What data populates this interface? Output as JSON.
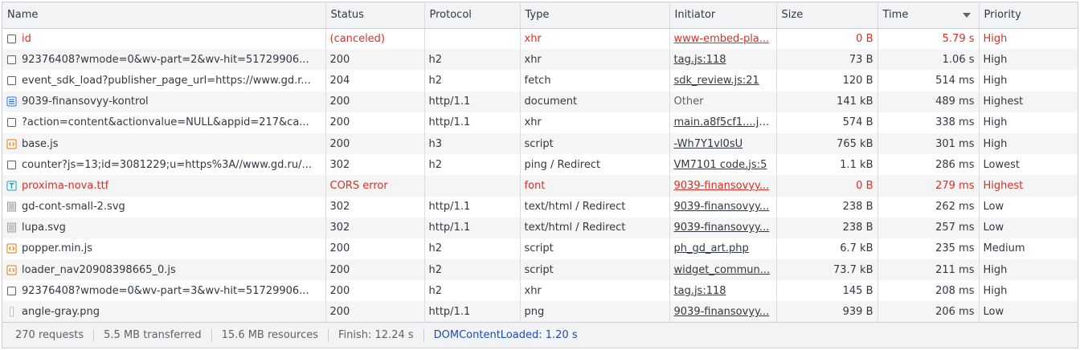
{
  "columns": {
    "name": "Name",
    "status": "Status",
    "protocol": "Protocol",
    "type": "Type",
    "initiator": "Initiator",
    "size": "Size",
    "time": "Time",
    "priority": "Priority"
  },
  "sort": {
    "column": "time",
    "direction": "descending"
  },
  "colors": {
    "error": "#d93025",
    "doc_icon": "#1a73e8",
    "script_icon": "#e37400",
    "font_icon": "#129eaf",
    "dcl": "#1a4cc7"
  },
  "rows": [
    {
      "icon": "generic-file-icon",
      "name": "id",
      "status": "(canceled)",
      "protocol": "",
      "type": "xhr",
      "initiator": "www-embed-pla...",
      "size": "0 B",
      "time": "5.79 s",
      "priority": "High",
      "error": true
    },
    {
      "icon": "generic-file-icon",
      "name": "92376408?wmode=0&wv-part=2&wv-hit=51729906...",
      "status": "200",
      "protocol": "h2",
      "type": "xhr",
      "initiator": "tag.js:118",
      "size": "73 B",
      "time": "1.06 s",
      "priority": "High"
    },
    {
      "icon": "generic-file-icon",
      "name": "event_sdk_load?publisher_page_url=https://www.gd.r...",
      "status": "204",
      "protocol": "h2",
      "type": "fetch",
      "initiator": "sdk_review.js:21",
      "size": "120 B",
      "time": "514 ms",
      "priority": "High"
    },
    {
      "icon": "document-icon",
      "name": "9039-finansovyy-kontrol",
      "status": "200",
      "protocol": "http/1.1",
      "type": "document",
      "initiator": "Other",
      "size": "141 kB",
      "time": "489 ms",
      "priority": "Highest",
      "initiator_plain": true
    },
    {
      "icon": "generic-file-icon",
      "name": "?action=content&actionvalue=NULL&appid=217&ca...",
      "status": "200",
      "protocol": "http/1.1",
      "type": "xhr",
      "initiator": "main.a8f5cf1....js:1",
      "size": "574 B",
      "time": "338 ms",
      "priority": "High"
    },
    {
      "icon": "script-icon",
      "name": "base.js",
      "status": "200",
      "protocol": "h3",
      "type": "script",
      "initiator": "-Wh7Y1vl0sU",
      "size": "765 kB",
      "time": "301 ms",
      "priority": "High"
    },
    {
      "icon": "generic-file-icon",
      "name": "counter?js=13;id=3081229;u=https%3A//www.gd.ru/...",
      "status": "302",
      "protocol": "h2",
      "type": "ping / Redirect",
      "initiator": "VM7101 code.js:5",
      "size": "1.1 kB",
      "time": "286 ms",
      "priority": "Lowest"
    },
    {
      "icon": "font-icon",
      "name": "proxima-nova.ttf",
      "status": "CORS error",
      "protocol": "",
      "type": "font",
      "initiator": "9039-finansovyy...",
      "size": "0 B",
      "time": "279 ms",
      "priority": "Highest",
      "error": true
    },
    {
      "icon": "image-icon",
      "name": "gd-cont-small-2.svg",
      "status": "302",
      "protocol": "http/1.1",
      "type": "text/html / Redirect",
      "initiator": "9039-finansovyy...",
      "size": "238 B",
      "time": "262 ms",
      "priority": "Low"
    },
    {
      "icon": "image-icon",
      "name": "lupa.svg",
      "status": "302",
      "protocol": "http/1.1",
      "type": "text/html / Redirect",
      "initiator": "9039-finansovyy...",
      "size": "238 B",
      "time": "257 ms",
      "priority": "Low"
    },
    {
      "icon": "script-icon",
      "name": "popper.min.js",
      "status": "200",
      "protocol": "h2",
      "type": "script",
      "initiator": "ph_gd_art.php",
      "size": "6.7 kB",
      "time": "235 ms",
      "priority": "Medium"
    },
    {
      "icon": "script-icon",
      "name": "loader_nav20908398665_0.js",
      "status": "200",
      "protocol": "h2",
      "type": "script",
      "initiator": "widget_commun...",
      "size": "73.7 kB",
      "time": "211 ms",
      "priority": "High"
    },
    {
      "icon": "generic-file-icon",
      "name": "92376408?wmode=0&wv-part=3&wv-hit=51729906...",
      "status": "200",
      "protocol": "h2",
      "type": "xhr",
      "initiator": "tag.js:118",
      "size": "145 B",
      "time": "208 ms",
      "priority": "High"
    },
    {
      "icon": "thin-image-icon",
      "name": "angle-gray.png",
      "status": "200",
      "protocol": "http/1.1",
      "type": "png",
      "initiator": "9039-finansovyy...",
      "size": "939 B",
      "time": "206 ms",
      "priority": "Low"
    }
  ],
  "statusbar": {
    "requests": "270 requests",
    "transferred": "5.5 MB transferred",
    "resources": "15.6 MB resources",
    "finish": "Finish: 12.24 s",
    "dcl": "DOMContentLoaded: 1.20 s"
  }
}
